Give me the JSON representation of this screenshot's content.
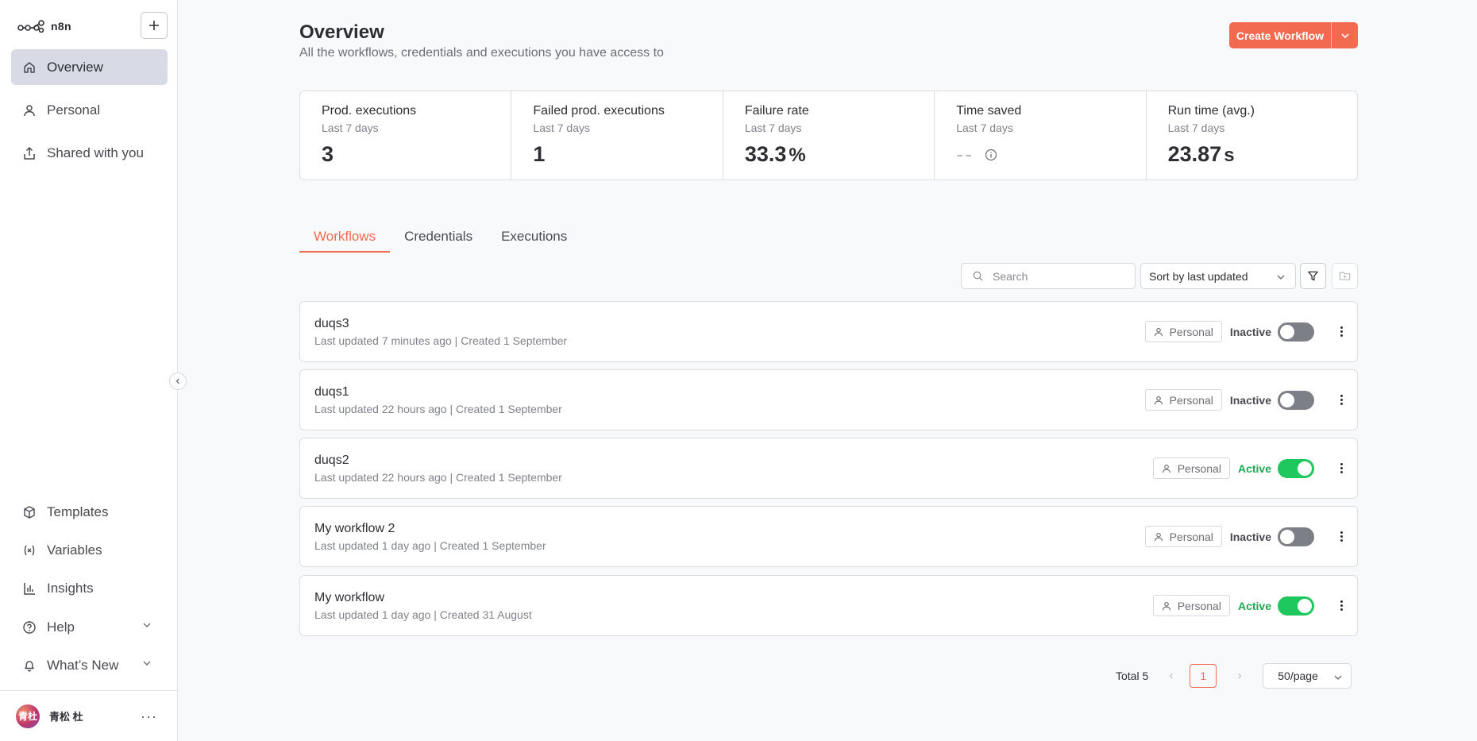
{
  "app": {
    "name": "n8n"
  },
  "sidebar": {
    "nav": [
      {
        "label": "Overview",
        "icon": "home-icon"
      },
      {
        "label": "Personal",
        "icon": "user-icon"
      },
      {
        "label": "Shared with you",
        "icon": "share-icon"
      }
    ],
    "bottom": [
      {
        "label": "Templates",
        "icon": "box-icon"
      },
      {
        "label": "Variables",
        "icon": "variable-icon"
      },
      {
        "label": "Insights",
        "icon": "chart-icon"
      },
      {
        "label": "Help",
        "icon": "help-icon"
      },
      {
        "label": "What’s New",
        "icon": "bell-icon"
      }
    ],
    "user": {
      "avatar_text": "青杜",
      "name": "青松 杜"
    }
  },
  "header": {
    "title": "Overview",
    "subtitle": "All the workflows, credentials and executions you have access to",
    "create_button": "Create Workflow"
  },
  "stats": [
    {
      "title": "Prod. executions",
      "sub": "Last 7 days",
      "value": "3",
      "unit": ""
    },
    {
      "title": "Failed prod. executions",
      "sub": "Last 7 days",
      "value": "1",
      "unit": ""
    },
    {
      "title": "Failure rate",
      "sub": "Last 7 days",
      "value": "33.3",
      "unit": "%"
    },
    {
      "title": "Time saved",
      "sub": "Last 7 days",
      "value": "--",
      "unit": ""
    },
    {
      "title": "Run time (avg.)",
      "sub": "Last 7 days",
      "value": "23.87",
      "unit": "s"
    }
  ],
  "tabs": [
    "Workflows",
    "Credentials",
    "Executions"
  ],
  "toolbar": {
    "search_placeholder": "Search",
    "sort_label": "Sort by last updated"
  },
  "workflows": [
    {
      "name": "duqs3",
      "meta": "Last updated 7 minutes ago | Created 1 September",
      "owner": "Personal",
      "status": "Inactive",
      "active": false
    },
    {
      "name": "duqs1",
      "meta": "Last updated 22 hours ago | Created 1 September",
      "owner": "Personal",
      "status": "Inactive",
      "active": false
    },
    {
      "name": "duqs2",
      "meta": "Last updated 22 hours ago | Created 1 September",
      "owner": "Personal",
      "status": "Active",
      "active": true
    },
    {
      "name": "My workflow 2",
      "meta": "Last updated 1 day ago | Created 1 September",
      "owner": "Personal",
      "status": "Inactive",
      "active": false
    },
    {
      "name": "My workflow",
      "meta": "Last updated 1 day ago | Created 31 August",
      "owner": "Personal",
      "status": "Active",
      "active": true
    }
  ],
  "pagination": {
    "total": "Total 5",
    "page": "1",
    "per_page": "50/page"
  },
  "colors": {
    "accent": "#f26b50",
    "active_green": "#1fc85f",
    "inactive_gray": "#7d7f86"
  }
}
